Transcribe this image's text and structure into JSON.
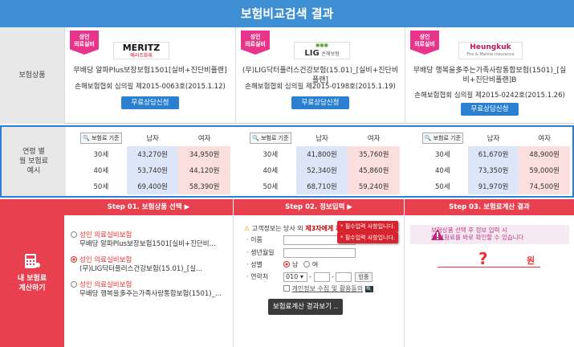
{
  "header": {
    "title": "보험비교검색 결과"
  },
  "sections": {
    "products_label": "보험상품",
    "premium_label": "연령 별\n월 보험료\n예시",
    "calc_label": "내 보험료\n계산하기"
  },
  "products": [
    {
      "ribbon": "성인\n의료실비",
      "logo": "MERITZ",
      "logo_sub": "메리츠화재",
      "name": "무배당 알파Plus보장보험1501[실비+진단비플랜]",
      "cert": "손해보험협회 심의필 제2015-0063호(2015.1.12)",
      "button": "무료상담신청",
      "color": "#c8102e"
    },
    {
      "ribbon": "성인\n의료실비",
      "logo": "LIG",
      "logo_sub": "손해보험",
      "name": "(무)LIG닥터플러스건강보험(15.01)_[실비+진단비플랜]",
      "cert": "손해보험협회 심의필 제2015-0198호(2015.1.19)",
      "button": "무료상담신청",
      "color": "#444"
    },
    {
      "ribbon": "성인\n의료실비",
      "logo": "Heungkuk",
      "logo_sub": "Fire & Marine Insurance",
      "name": "무배당 행복을多주는가족사랑통합보험(1501)_[실비+진단비플랜]B",
      "cert": "손해보험협회 심의필 제2015-0242호(2015.1.26)",
      "button": "무료상담신청",
      "color": "#c2185b"
    }
  ],
  "premiums": [
    {
      "tag": "보험료 기준",
      "male": "남자",
      "female": "여자",
      "rows": [
        [
          "30세",
          "43,270원",
          "34,950원"
        ],
        [
          "40세",
          "53,740원",
          "44,120원"
        ],
        [
          "50세",
          "69,400원",
          "58,390원"
        ]
      ]
    },
    {
      "tag": "보험료 기준",
      "male": "남자",
      "female": "여자",
      "rows": [
        [
          "30세",
          "41,800원",
          "35,760원"
        ],
        [
          "40세",
          "52,340원",
          "45,860원"
        ],
        [
          "50세",
          "68,710원",
          "59,240원"
        ]
      ]
    },
    {
      "tag": "보험료 기준",
      "male": "남자",
      "female": "여자",
      "rows": [
        [
          "30세",
          "61,670원",
          "48,900원"
        ],
        [
          "40세",
          "73,350원",
          "59,000원"
        ],
        [
          "50세",
          "91,970원",
          "74,500원"
        ]
      ]
    }
  ],
  "steps": {
    "s1": "Step 01. 보험상품 선택 ▶",
    "s2": "Step 02. 정보입력 ▶",
    "s3": "Step 03. 보험료계산 결과"
  },
  "options": [
    {
      "title": "성인 의료실비보험",
      "desc": "무배당 알파Plus보장보험1501[실비+진단비..."
    },
    {
      "title": "성인 의료실비보험",
      "desc": "(무)LIG닥터플러스건강보험(15.01)_[실..."
    },
    {
      "title": "성인 의료실비보험",
      "desc": "무배당 행복을多주는가족사랑통합보험(1501)_..."
    }
  ],
  "form": {
    "notice_a": "고객정보는 당사 외 ",
    "notice_b": "제3자에게 제",
    "name": "이름",
    "birth": "생년월일",
    "gender": "성별",
    "male": "남",
    "female": "여",
    "phone": "연락처",
    "phone_prefix": "010",
    "verify": "인증",
    "privacy": "개인정보 수집 및 활용동의",
    "submit": "보험료계산 결과보기 ..",
    "tip1": "* 필수입력 사항입니다.",
    "tip2": "* 필수입력 사항입니다."
  },
  "result": {
    "notice": "보험상품 선택 후 정보 입력 시\n월 보험료를 바로 확인할 수 있습니다",
    "mark": "?",
    "unit": "원"
  }
}
